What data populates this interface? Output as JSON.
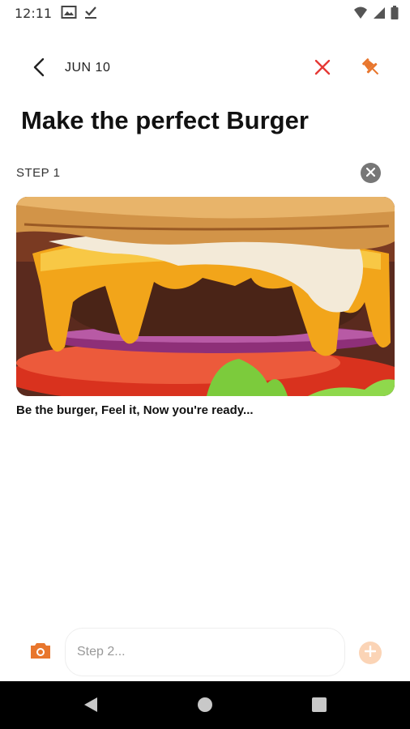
{
  "status_bar": {
    "time": "12:11",
    "icons": [
      "gallery-icon",
      "check-icon",
      "wifi-icon",
      "signal-icon",
      "battery-icon"
    ]
  },
  "top_bar": {
    "date": "JUN 10",
    "icons": [
      "back-arrow-icon",
      "close-icon",
      "pin-icon"
    ]
  },
  "note": {
    "title": "Make the perfect Burger",
    "steps": [
      {
        "label": "STEP 1",
        "image": "burger-photo",
        "text": "Be the burger, Feel it, Now you're ready..."
      }
    ]
  },
  "composer": {
    "input_placeholder": "Step 2...",
    "input_value": ""
  },
  "colors": {
    "accent": "#e8762d",
    "delete": "#e53935",
    "remove_badge": "#777777",
    "add_button_disabled": "#fbd4b6",
    "nav_bar": "#000000"
  },
  "nav_bar": {
    "icons": [
      "back-triangle-icon",
      "home-circle-icon",
      "recents-square-icon"
    ]
  }
}
